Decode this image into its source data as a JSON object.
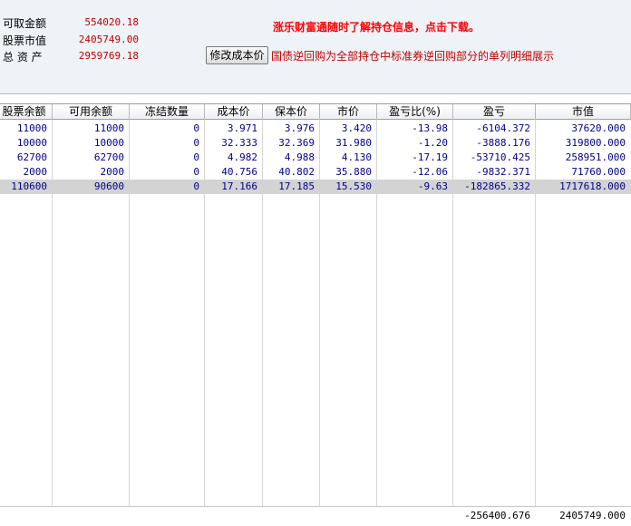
{
  "summary": {
    "available_label": "可取金额",
    "available_value": "554020.18",
    "stock_value_label": "股票市值",
    "stock_value": "2405749.00",
    "total_assets_label": "总 资 产",
    "total_assets_value": "2959769.18"
  },
  "promo_text": "涨乐财富通随时了解持仓信息，点击下载。",
  "modify_cost_button": "修改成本价",
  "repo_link": "国债逆回购为全部持仓中标准券逆回购部分的单列明细展示",
  "table": {
    "columns": [
      "股票余额",
      "可用余额",
      "冻结数量",
      "成本价",
      "保本价",
      "市价",
      "盈亏比(%)",
      "盈亏",
      "市值"
    ],
    "rows": [
      [
        "11000",
        "11000",
        "0",
        "3.971",
        "3.976",
        "3.420",
        "-13.98",
        "-6104.372",
        "37620.000"
      ],
      [
        "10000",
        "10000",
        "0",
        "32.333",
        "32.369",
        "31.980",
        "-1.20",
        "-3888.176",
        "319800.000"
      ],
      [
        "62700",
        "62700",
        "0",
        "4.982",
        "4.988",
        "4.130",
        "-17.19",
        "-53710.425",
        "258951.000"
      ],
      [
        "2000",
        "2000",
        "0",
        "40.756",
        "40.802",
        "35.880",
        "-12.06",
        "-9832.371",
        "71760.000"
      ],
      [
        "110600",
        "90600",
        "0",
        "17.166",
        "17.185",
        "15.530",
        "-9.63",
        "-182865.332",
        "1717618.000"
      ]
    ],
    "selected_row": 4,
    "footer": {
      "pnl_total": "-256400.676",
      "market_value_total": "2405749.000"
    }
  }
}
